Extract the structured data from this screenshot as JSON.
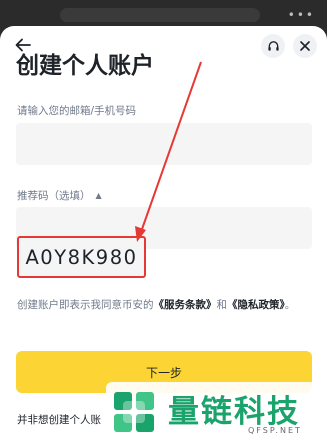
{
  "page": {
    "title": "创建个人账户",
    "email_label": "请输入您的邮箱/手机号码",
    "email_value": "",
    "referral_label": "推荐码（选填）",
    "referral_value": "A0Y8K980",
    "terms_prefix": "创建账户即表示我同意币安的",
    "terms_service": "《服务条款》",
    "terms_and": "和",
    "terms_privacy": "《隐私政策》",
    "terms_suffix": "。",
    "next_button": "下一步",
    "no_personal_text": "并非想创建个人账"
  },
  "icons": {
    "back": "arrow-left-icon",
    "headset": "headset-icon",
    "close": "close-icon",
    "caret": "caret-up-icon"
  },
  "watermark": {
    "name": "量链科技",
    "domain": "QFSP.NET"
  },
  "colors": {
    "accent": "#fcd535",
    "annotation": "#e53935",
    "watermark": "#1aa36b",
    "text": "#1e2329",
    "muted": "#707a8a"
  }
}
